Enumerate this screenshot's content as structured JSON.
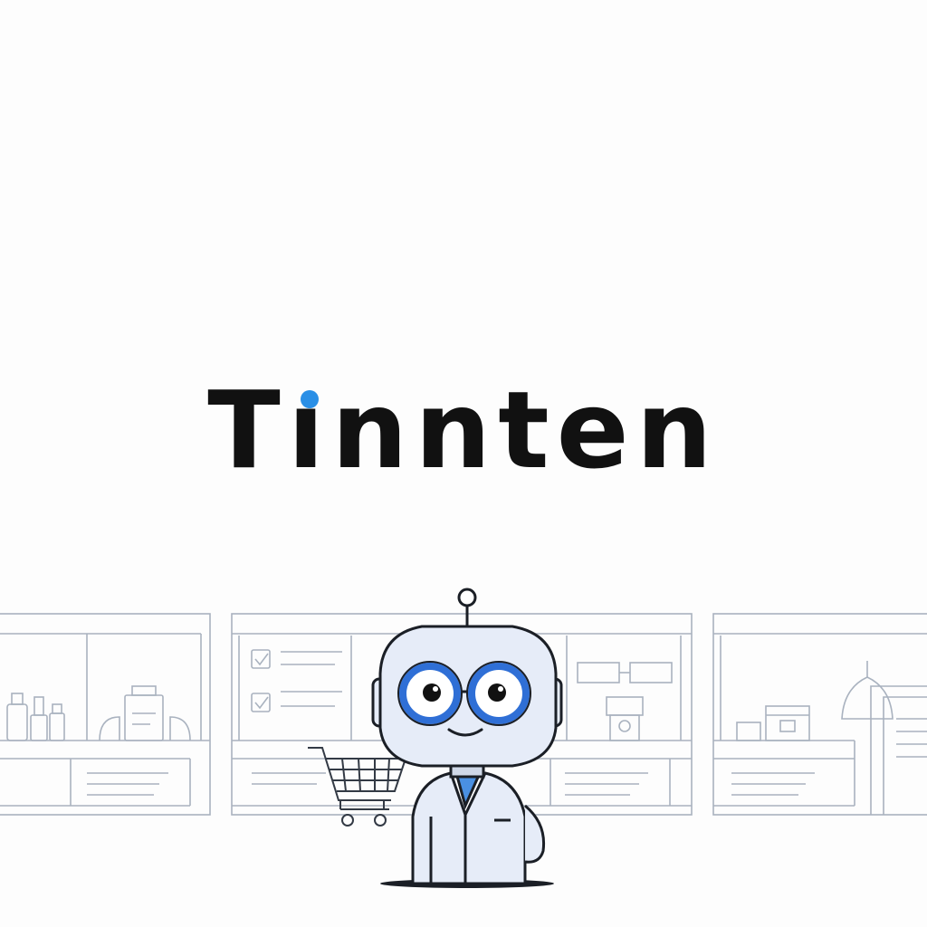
{
  "brand": {
    "name_before_i": "T",
    "name_i": "ı",
    "name_after_i": "nnten",
    "text_color": "#111111",
    "dot_color": "#2a8fe6"
  },
  "illustration": {
    "subject": "robot-mascot",
    "props": [
      "shopping-cart-icon",
      "checkbox-icon",
      "lamp-icon",
      "bottle-icon"
    ],
    "line_color": "#a9b2bf",
    "robot_face_color": "#e6ecf8",
    "robot_eye_ring_color": "#2f6fd6"
  }
}
